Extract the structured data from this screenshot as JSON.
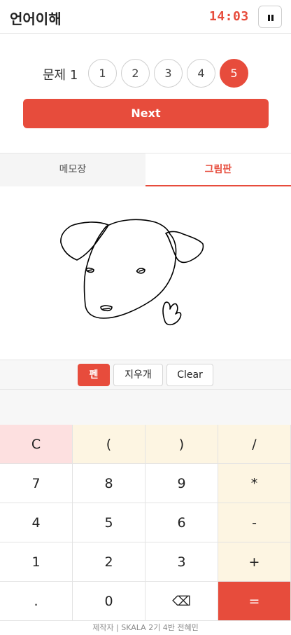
{
  "header": {
    "title": "언어이해",
    "timer": "14:03"
  },
  "questions": {
    "label": "문제 1",
    "numbers": [
      "1",
      "2",
      "3",
      "4",
      "5"
    ],
    "active": "5"
  },
  "next_label": "Next",
  "tabs": {
    "memo": "메모장",
    "draw": "그림판"
  },
  "tools": {
    "pen": "펜",
    "eraser": "지우개",
    "clear": "Clear"
  },
  "calculator": {
    "row1": [
      "C",
      "(",
      ")",
      "/"
    ],
    "row2": [
      "7",
      "8",
      "9",
      "*"
    ],
    "row3": [
      "4",
      "5",
      "6",
      "-"
    ],
    "row4": [
      "1",
      "2",
      "3",
      "+"
    ],
    "row5": [
      ".",
      "0",
      "⌫",
      "="
    ]
  },
  "footer": "제작자 | SKALA 2기 4반 전혜민",
  "colors": {
    "accent": "#e74c3c",
    "paren_op_bg": "#fdf5e2",
    "clear_bg": "#fde0e0"
  }
}
